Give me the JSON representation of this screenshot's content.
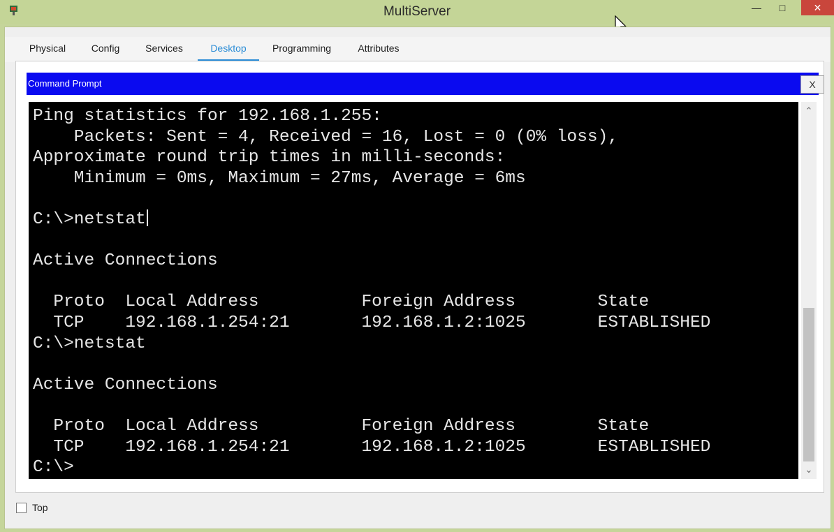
{
  "window": {
    "title": "MultiServer",
    "minimize_glyph": "—",
    "maximize_glyph": "□",
    "close_glyph": "✕"
  },
  "tabs": [
    {
      "label": "Physical",
      "active": false
    },
    {
      "label": "Config",
      "active": false
    },
    {
      "label": "Services",
      "active": false
    },
    {
      "label": "Desktop",
      "active": true
    },
    {
      "label": "Programming",
      "active": false
    },
    {
      "label": "Attributes",
      "active": false
    }
  ],
  "command_prompt": {
    "title": "Command Prompt",
    "close_label": "X",
    "lines": [
      "Ping statistics for 192.168.1.255:",
      "    Packets: Sent = 4, Received = 16, Lost = 0 (0% loss),",
      "Approximate round trip times in milli-seconds:",
      "    Minimum = 0ms, Maximum = 27ms, Average = 6ms",
      "",
      "C:\\>netstat",
      "",
      "Active Connections",
      "",
      "  Proto  Local Address          Foreign Address        State",
      "  TCP    192.168.1.254:21       192.168.1.2:1025       ESTABLISHED",
      "C:\\>netstat",
      "",
      "Active Connections",
      "",
      "  Proto  Local Address          Foreign Address        State",
      "  TCP    192.168.1.254:21       192.168.1.2:1025       ESTABLISHED",
      "C:\\>"
    ]
  },
  "footer": {
    "top_label": "Top",
    "top_checked": false
  },
  "colors": {
    "titlebar": "#c4d597",
    "cmd_header": "#0a0af0",
    "active_tab": "#2a8cd6",
    "close_button": "#c9463c"
  }
}
